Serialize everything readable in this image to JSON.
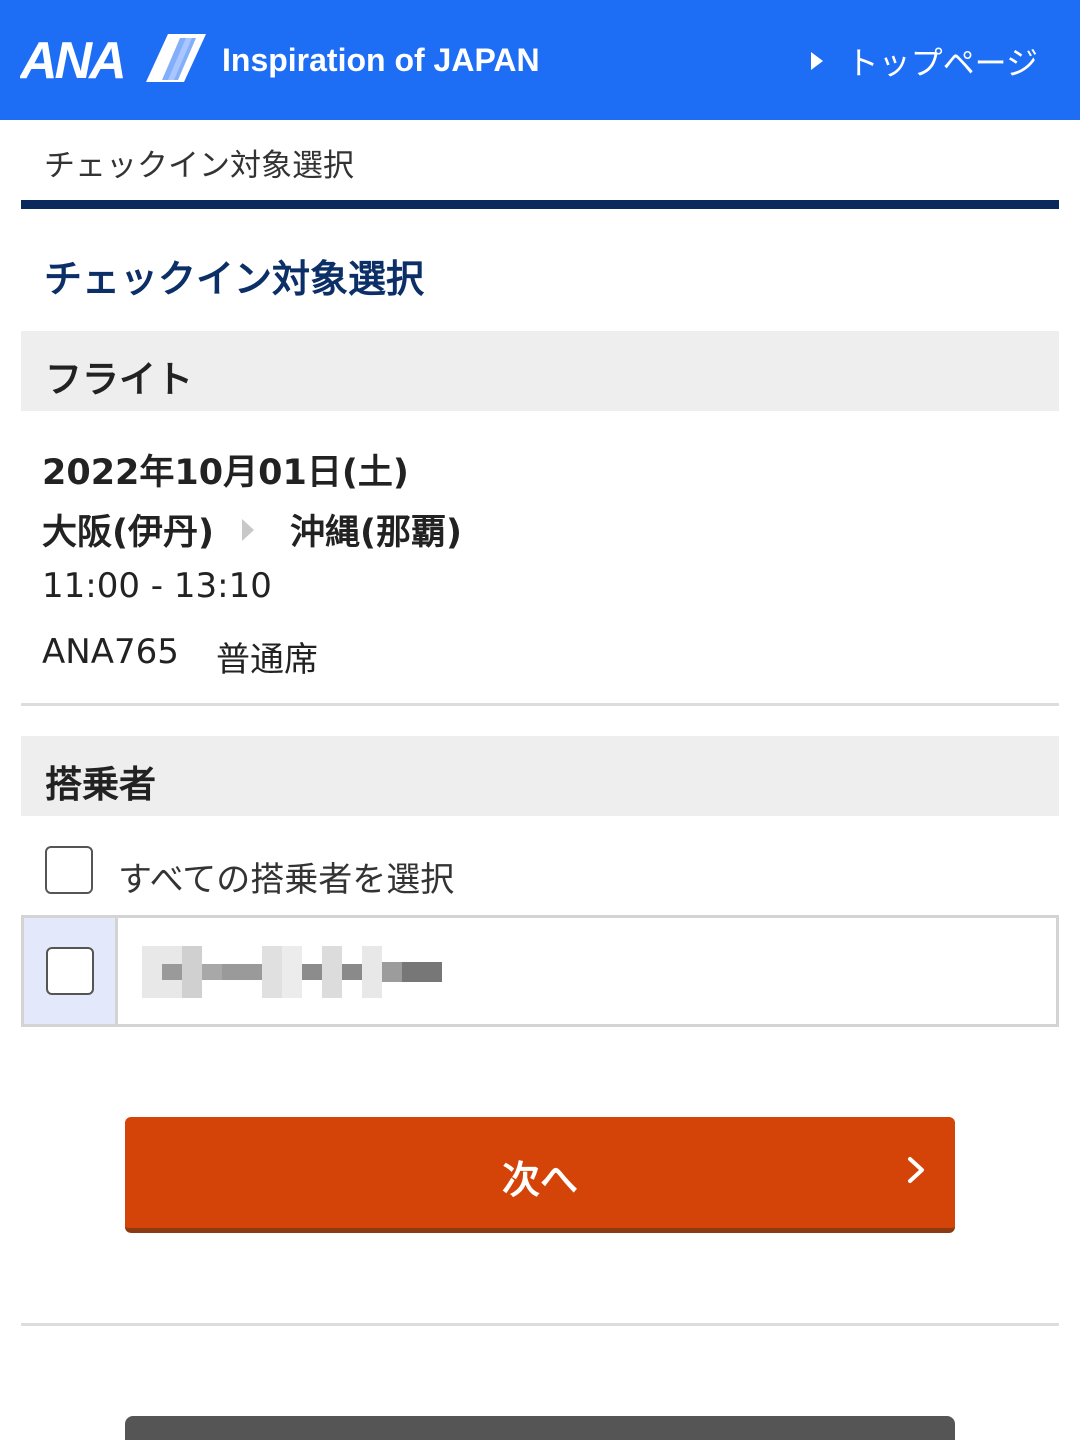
{
  "header": {
    "logo_text": "ANA",
    "tagline": "Inspiration of JAPAN",
    "top_link_label": "トップページ",
    "background_color": "#1e6ef5"
  },
  "breadcrumb": {
    "label": "チェックイン対象選択"
  },
  "page_title": "チェックイン対象選択",
  "flight_section": {
    "heading": "フライト",
    "date": "2022年10月01日(土)",
    "origin": "大阪(伊丹)",
    "destination": "沖縄(那覇)",
    "time": "11:00 - 13:10",
    "flight_number": "ANA765",
    "seat_class": "普通席"
  },
  "passenger_section": {
    "heading": "搭乗者",
    "select_all_label": "すべての搭乗者を選択",
    "select_all_checked": false,
    "passengers": [
      {
        "name_obscured": true,
        "checked": false
      }
    ]
  },
  "actions": {
    "next_label": "次へ",
    "next_color": "#d44408"
  },
  "icons": {
    "top_link_arrow": "triangle-right-icon",
    "route_arrow": "triangle-right-icon",
    "next_chevron": "chevron-right-icon"
  }
}
